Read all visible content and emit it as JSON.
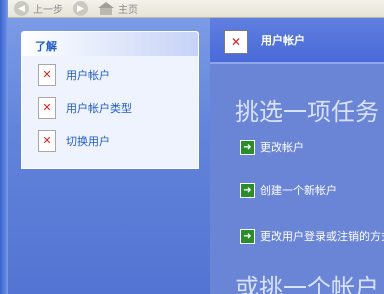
{
  "toolbar": {
    "back_label": "上一步",
    "forward_icon": "forward-arrow-icon",
    "home_label": "主页"
  },
  "learn_box": {
    "title": "了解",
    "items": [
      {
        "label": "用户帐户"
      },
      {
        "label": "用户帐户类型"
      },
      {
        "label": "切换用户"
      }
    ]
  },
  "main": {
    "header_title": "用户帐户",
    "heading": "挑选一项任务",
    "tasks": [
      {
        "label": "更改帐户"
      },
      {
        "label": "创建一个新帐户"
      },
      {
        "label": "更改用户登录或注销的方式"
      }
    ],
    "heading2": "或挑一个帐户"
  },
  "colors": {
    "pane_blue": "#6384db",
    "link_blue": "#215dc6",
    "arrow_green": "#2a8c2a",
    "error_red": "#d8221c"
  }
}
